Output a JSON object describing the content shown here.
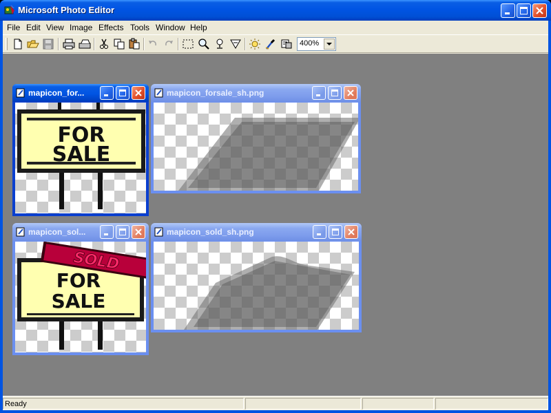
{
  "app": {
    "title": "Microsoft Photo Editor",
    "app_icon": "photo-editor-icon",
    "caption_buttons": [
      "minimize-icon",
      "maximize-icon",
      "close-icon"
    ]
  },
  "menu": {
    "items": [
      {
        "label": "File"
      },
      {
        "label": "Edit"
      },
      {
        "label": "View"
      },
      {
        "label": "Image"
      },
      {
        "label": "Effects"
      },
      {
        "label": "Tools"
      },
      {
        "label": "Window"
      },
      {
        "label": "Help"
      }
    ]
  },
  "toolbar": {
    "buttons": [
      "new-icon",
      "open-icon",
      "save-icon",
      "print-icon",
      "scan-icon",
      "cut-icon",
      "copy-icon",
      "paste-icon",
      "undo-icon",
      "redo-icon",
      "select-icon",
      "zoom-icon",
      "smudge-icon",
      "transparency-icon",
      "brightness-icon",
      "eyedropper-icon",
      "properties-icon"
    ],
    "zoom": "400%"
  },
  "documents": [
    {
      "title": "mapicon_for...",
      "state": "active",
      "sign_text": [
        "FOR",
        "SALE"
      ]
    },
    {
      "title": "mapicon_forsale_sh.png",
      "state": "inactive"
    },
    {
      "title": "mapicon_sol...",
      "state": "inactive",
      "sign_text": [
        "SOLD",
        "FOR",
        "SALE"
      ]
    },
    {
      "title": "mapicon_sold_sh.png",
      "state": "inactive"
    }
  ],
  "status": {
    "text": "Ready"
  },
  "colors": {
    "titlebar": "#0054e3",
    "mdi_background": "#808080",
    "sign_face": "#ffffb0",
    "sold_banner": "#b8003a",
    "sold_text": "#ff2a6a"
  }
}
